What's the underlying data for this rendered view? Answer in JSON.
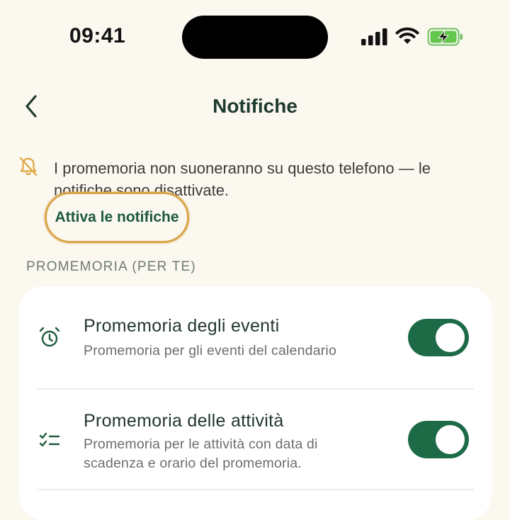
{
  "status_bar": {
    "time": "09:41"
  },
  "nav": {
    "title": "Notifiche"
  },
  "banner": {
    "message": "I promemoria non suoneranno su questo telefono — le notifiche sono disattivate.",
    "action_label": "Attiva le notifiche"
  },
  "section": {
    "header": "PROMEMORIA (PER TE)"
  },
  "settings": [
    {
      "icon": "alarm-clock-icon",
      "title": "Promemoria degli eventi",
      "subtitle": "Promemoria per gli eventi del calendario",
      "enabled": true
    },
    {
      "icon": "checklist-icon",
      "title": "Promemoria delle attività",
      "subtitle": "Promemoria per le attività con data di scadenza e orario del promemoria.",
      "enabled": true
    }
  ],
  "colors": {
    "background": "#fbf8f0",
    "accent_green": "#1d6a47",
    "highlight_outline": "#d8a548",
    "warning_icon": "#e0a640"
  }
}
